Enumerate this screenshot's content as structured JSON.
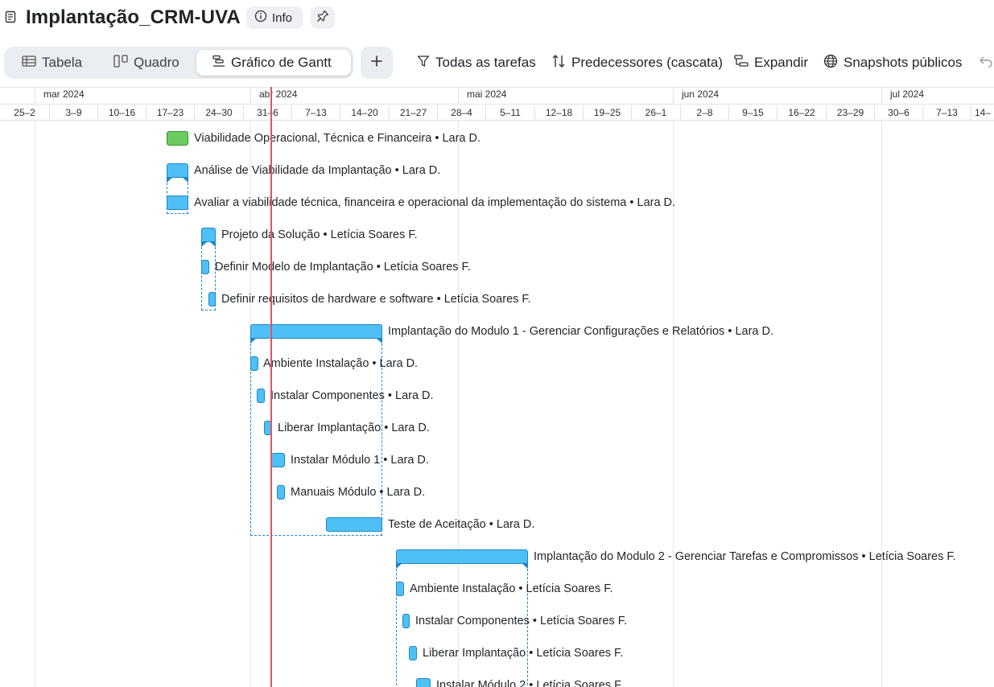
{
  "header": {
    "title": "Implantação_CRM-UVA",
    "info_label": "Info"
  },
  "view_tabs": [
    {
      "label": "Tabela",
      "icon": "table-icon"
    },
    {
      "label": "Quadro",
      "icon": "board-icon"
    },
    {
      "label": "Gráfico de Gantt",
      "icon": "gantt-icon",
      "active": true
    }
  ],
  "toolbar": {
    "filter_label": "Todas as tarefas",
    "predecessors_label": "Predecessores (cascata)",
    "expand_label": "Expandir",
    "snapshots_label": "Snapshots públicos"
  },
  "timeline": {
    "months": [
      "mar 2024",
      "abr 2024",
      "mai 2024",
      "jun 2024",
      "jul 2024"
    ],
    "weeks": [
      "25–2",
      "3–9",
      "10–16",
      "17–23",
      "24–30",
      "31–6",
      "7–13",
      "14–20",
      "21–27",
      "28–4",
      "5–11",
      "12–18",
      "19–25",
      "26–1",
      "2–8",
      "9–15",
      "16–22",
      "23–29",
      "30–6",
      "7–13",
      "14–"
    ]
  },
  "tasks": [
    {
      "name": "Viabilidade Operacional, Técnica e Financeira",
      "assignee": "Lara D.",
      "status": "done"
    },
    {
      "name": "Análise de Viabilidade da Implantação",
      "assignee": "Lara D.",
      "status": "group"
    },
    {
      "name": "Avaliar a viabilidade técnica, financeira e operacional da implementação do sistema",
      "assignee": "Lara D.",
      "status": "open"
    },
    {
      "name": "Projeto da Solução",
      "assignee": "Letícia Soares F.",
      "status": "group"
    },
    {
      "name": "Definir Modelo de Implantação",
      "assignee": "Letícia Soares F.",
      "status": "open"
    },
    {
      "name": "Definir requisitos de hardware e software",
      "assignee": "Letícia Soares F.",
      "status": "open"
    },
    {
      "name": "Implantação do Modulo 1 - Gerenciar Configurações e Relatórios",
      "assignee": "Lara D.",
      "status": "group"
    },
    {
      "name": "Ambiente Instalação",
      "assignee": "Lara D.",
      "status": "open"
    },
    {
      "name": "Instalar Componentes",
      "assignee": "Lara D.",
      "status": "open"
    },
    {
      "name": "Liberar Implantação",
      "assignee": "Lara D.",
      "status": "open"
    },
    {
      "name": "Instalar Módulo 1",
      "assignee": "Lara D.",
      "status": "open"
    },
    {
      "name": "Manuais Módulo",
      "assignee": "Lara D.",
      "status": "open"
    },
    {
      "name": "Teste de Aceitação",
      "assignee": "Lara D.",
      "status": "open"
    },
    {
      "name": "Implantação do Modulo 2 - Gerenciar Tarefas e Compromissos",
      "assignee": "Letícia Soares F.",
      "status": "group"
    },
    {
      "name": "Ambiente Instalação",
      "assignee": "Letícia Soares F.",
      "status": "open"
    },
    {
      "name": "Instalar Componentes",
      "assignee": "Letícia Soares F.",
      "status": "open"
    },
    {
      "name": "Liberar Implantação",
      "assignee": "Letícia Soares F.",
      "status": "open"
    },
    {
      "name": "Instalar Módulo 2",
      "assignee": "Letícia Soares F.",
      "status": "open"
    }
  ],
  "colors": {
    "bar": "#4fc0f5",
    "bar_border": "#1d86c6",
    "done": "#6ccb5f",
    "today_line": "#e05469"
  }
}
